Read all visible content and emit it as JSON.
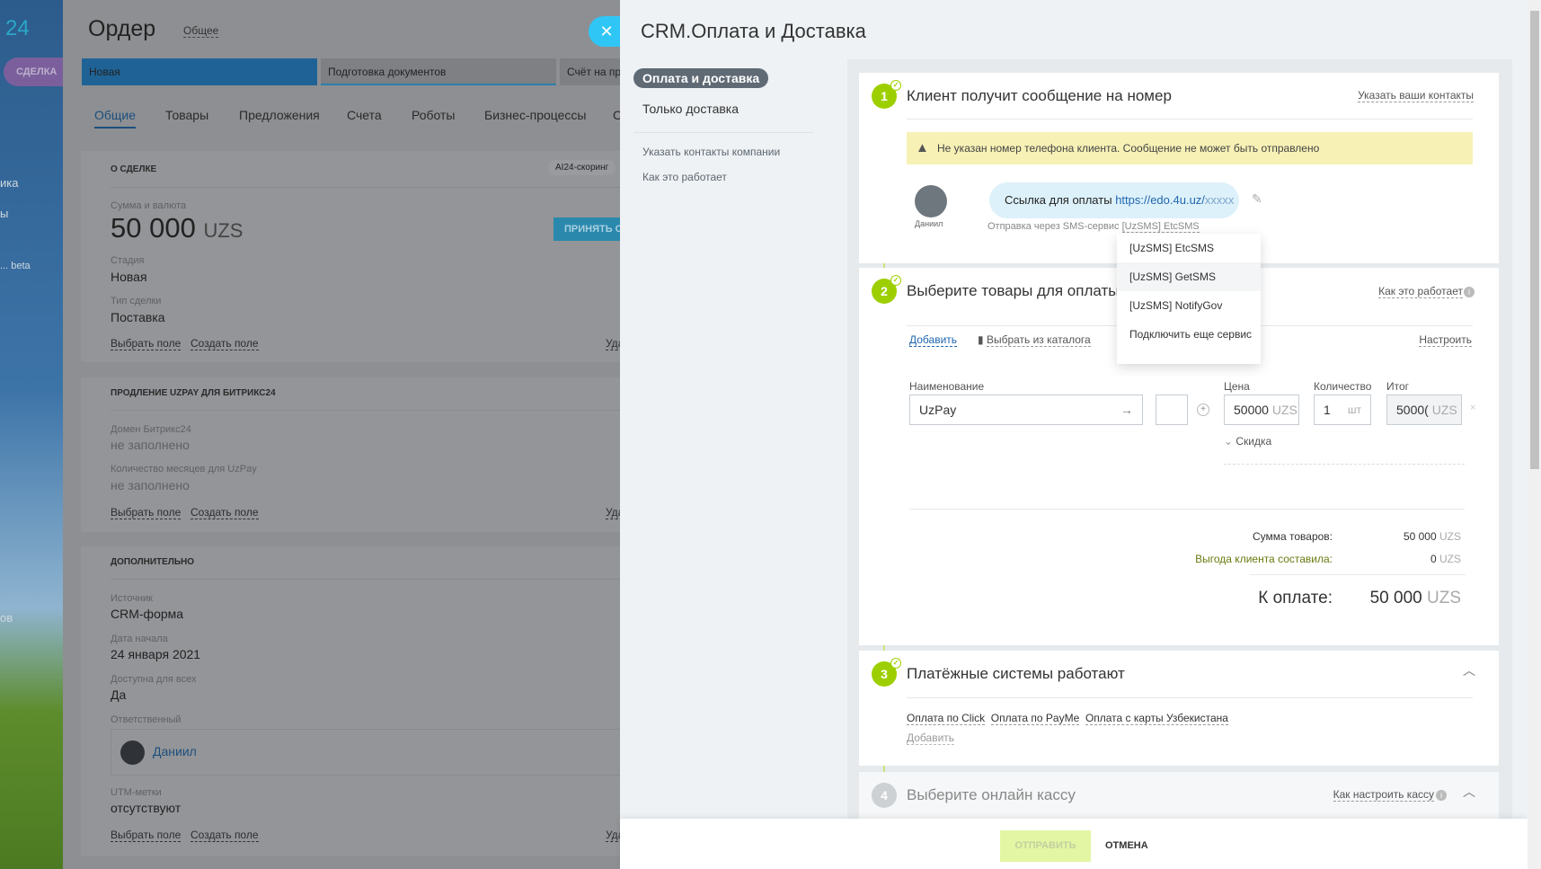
{
  "leftbar": {
    "logo": "24",
    "deal_badge": "СДЕЛКА",
    "items": [
      "ика",
      "ы",
      "... beta",
      "ов"
    ]
  },
  "deal": {
    "title": "Ордер",
    "category": "Общее",
    "stages": [
      "Новая",
      "Подготовка документов",
      "Счёт на пре"
    ],
    "tabs": [
      "Общие",
      "Товары",
      "Предложения",
      "Счета",
      "Роботы",
      "Бизнес-процессы",
      "С"
    ],
    "section_about": {
      "title": "О СДЕЛКЕ",
      "ai_badge": "AI24-скоринг",
      "sum_label": "Сумма и валюта",
      "sum": "50 000",
      "currency": "UZS",
      "accept_button": "ПРИНЯТЬ С",
      "stage_label": "Стадия",
      "stage": "Новая",
      "type_label": "Тип сделки",
      "type": "Поставка"
    },
    "section_uzpay": {
      "title": "ПРОДЛЕНИЕ UZPAY ДЛЯ БИТРИКС24",
      "domain_label": "Домен Битрикс24",
      "domain": "не заполнено",
      "months_label": "Количество месяцев для UzPay",
      "months": "не заполнено"
    },
    "section_extra": {
      "title": "ДОПОЛНИТЕЛЬНО",
      "source_label": "Источник",
      "source": "CRM-форма",
      "date_label": "Дата начала",
      "date": "24 января 2021",
      "public_label": "Доступна для всех",
      "public": "Да",
      "resp_label": "Ответственный",
      "resp": "Даниил",
      "utm_label": "UTM-метки",
      "utm": "отсутствуют"
    },
    "select_field": "Выбрать поле",
    "create_field": "Создать поле",
    "delete": "Удалит"
  },
  "panel": {
    "title": "CRM.Оплата и Доставка",
    "menu": {
      "active": "Оплата и доставка",
      "delivery": "Только доставка",
      "contacts": "Указать контакты компании",
      "how": "Как это работает"
    },
    "step1": {
      "num": "1",
      "title": "Клиент получит сообщение на номер",
      "link": "Указать ваши контакты",
      "warning": "Не указан номер телефона клиента. Сообщение не может быть отправлено",
      "avatar_name": "Даниил",
      "message_prefix": "Ссылка для оплаты",
      "message_url": "https://edo.4u.uz/",
      "message_url_tail": "xxxxx",
      "sent_via": "Отправка через SMS-сервис",
      "service": "[UzSMS] EtcSMS"
    },
    "dropdown": [
      "[UzSMS] EtcSMS",
      "[UzSMS] GetSMS",
      "[UzSMS] NotifyGov",
      "Подключить еще сервис"
    ],
    "step2": {
      "num": "2",
      "title": "Выберите товары для оплаты",
      "link": "Как это работает",
      "add": "Добавить",
      "catalog": "Выбрать из каталога",
      "configure": "Настроить",
      "col_name": "Наименование",
      "col_price": "Цена",
      "col_qty": "Количество",
      "col_total": "Итог",
      "product": "UzPay",
      "price": "50000",
      "price_cur": "UZS",
      "qty": "1",
      "unit": "шт",
      "total": "5000(",
      "total_cur": "UZS",
      "discount": "Скидка",
      "sum_label": "Сумма товаров:",
      "sum": "50 000",
      "benefit_label": "Выгода клиента составила:",
      "benefit": "0",
      "cur": "UZS",
      "pay_label": "К оплате:",
      "pay": "50 000"
    },
    "step3": {
      "num": "3",
      "title": "Платёжные системы работают",
      "systems": [
        "Оплата по Click",
        "Оплата по PayMe",
        "Оплата с карты Узбекистана"
      ],
      "add": "Добавить"
    },
    "step4": {
      "num": "4",
      "title": "Выберите онлайн кассу",
      "link": "Как настроить кассу"
    },
    "footer": {
      "send": "ОТПРАВИТЬ",
      "cancel": "ОТМЕНА"
    }
  },
  "colors": {
    "accent": "#9dcf00",
    "link": "#2067b0",
    "close": "#2fc6f6"
  }
}
